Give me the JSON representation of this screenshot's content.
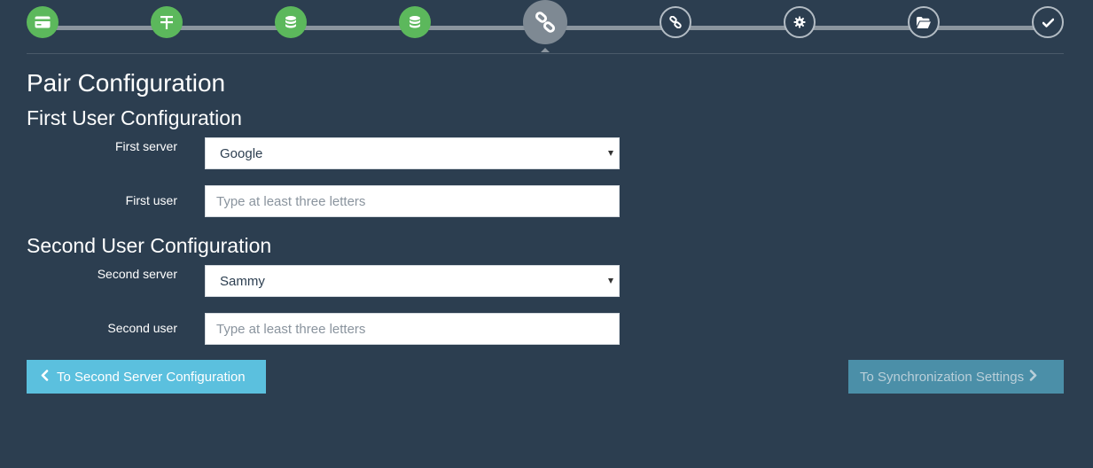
{
  "stepper": {
    "steps": [
      {
        "icon": "credit-card-icon",
        "state": "done"
      },
      {
        "icon": "server-icon",
        "state": "done"
      },
      {
        "icon": "database-icon",
        "state": "done"
      },
      {
        "icon": "database-icon",
        "state": "done"
      },
      {
        "icon": "link-icon",
        "state": "active"
      },
      {
        "icon": "link-icon",
        "state": "todo"
      },
      {
        "icon": "gear-icon",
        "state": "todo"
      },
      {
        "icon": "folder-open-icon",
        "state": "todo"
      },
      {
        "icon": "checkmark-icon",
        "state": "todo"
      }
    ],
    "colors": {
      "done": "#5cb85c",
      "active": "#7e8993",
      "todo_border": "#b3bcc4",
      "line": "#8b959e"
    }
  },
  "page": {
    "title": "Pair Configuration"
  },
  "first_user": {
    "heading": "First User Configuration",
    "server_label": "First server",
    "server_value": "Google",
    "user_label": "First user",
    "user_placeholder": "Type at least three letters"
  },
  "second_user": {
    "heading": "Second User Configuration",
    "server_label": "Second server",
    "server_value": "Sammy",
    "user_label": "Second user",
    "user_placeholder": "Type at least three letters"
  },
  "nav": {
    "prev_label": "To Second Server Configuration",
    "next_label": "To Synchronization Settings"
  },
  "colors": {
    "background": "#2c3e50",
    "prev_button": "#5bc0de",
    "next_button": "#4b8fa8"
  }
}
